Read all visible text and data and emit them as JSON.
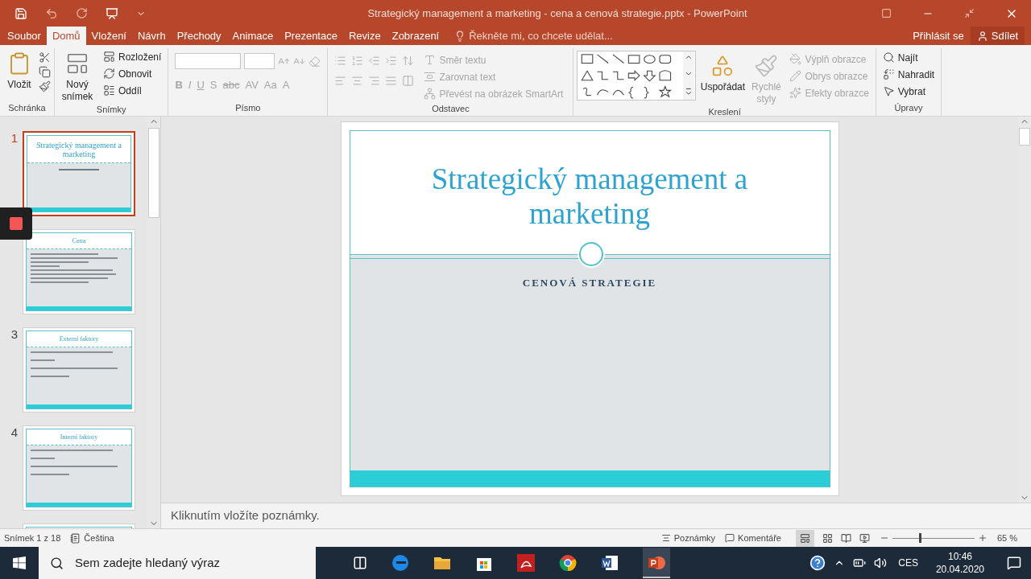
{
  "title_bar": {
    "title": "Strategický management a marketing - cena a cenová strategie.pptx - PowerPoint"
  },
  "menu_tabs": [
    {
      "label": "Soubor",
      "selected": false
    },
    {
      "label": "Domů",
      "selected": true
    },
    {
      "label": "Vložení",
      "selected": false
    },
    {
      "label": "Návrh",
      "selected": false
    },
    {
      "label": "Přechody",
      "selected": false
    },
    {
      "label": "Animace",
      "selected": false
    },
    {
      "label": "Prezentace",
      "selected": false
    },
    {
      "label": "Revize",
      "selected": false
    },
    {
      "label": "Zobrazení",
      "selected": false
    }
  ],
  "tell_me": {
    "placeholder": "Řekněte mi, co chcete udělat..."
  },
  "account": {
    "sign_in": "Přihlásit se",
    "share": "Sdílet"
  },
  "ribbon_groups": [
    {
      "kind": "clipboard",
      "name": "Schránka",
      "large": [
        {
          "label": "Vložit",
          "disabled": false
        }
      ]
    },
    {
      "kind": "slides",
      "name": "Snímky",
      "large": [
        {
          "label": "Nový snímek",
          "disabled": false
        }
      ],
      "small": [
        {
          "label": "Rozložení",
          "disabled": false
        },
        {
          "label": "Obnovit",
          "disabled": false
        },
        {
          "label": "Oddíl",
          "disabled": false
        }
      ]
    },
    {
      "kind": "font",
      "name": "Písmo",
      "format_buttons": [
        {
          "label": "B",
          "disabled": true
        },
        {
          "label": "I",
          "disabled": true
        },
        {
          "label": "U",
          "disabled": true
        },
        {
          "label": "S",
          "disabled": true
        },
        {
          "label": "abc",
          "disabled": true
        },
        {
          "label": "AV",
          "disabled": true
        },
        {
          "label": "Aa",
          "disabled": true
        },
        {
          "label": "A",
          "disabled": true
        }
      ]
    },
    {
      "kind": "paragraph",
      "name": "Odstavec",
      "small": [
        {
          "label": "Směr textu",
          "disabled": true
        },
        {
          "label": "Zarovnat text",
          "disabled": true
        },
        {
          "label": "Převést na obrázek SmartArt",
          "disabled": true
        }
      ]
    },
    {
      "kind": "drawing",
      "name": "Kreslení",
      "large": [
        {
          "label": "Uspořádat",
          "disabled": false
        },
        {
          "label": "Rychlé styly",
          "disabled": true
        }
      ],
      "small": [
        {
          "label": "Výplň obrazce",
          "disabled": true
        },
        {
          "label": "Obrys obrazce",
          "disabled": true
        },
        {
          "label": "Efekty obrazce",
          "disabled": true
        }
      ]
    },
    {
      "kind": "editing",
      "name": "Úpravy",
      "small": [
        {
          "label": "Najít",
          "disabled": false
        },
        {
          "label": "Nahradit",
          "disabled": false
        },
        {
          "label": "Vybrat",
          "disabled": false
        }
      ]
    }
  ],
  "thumbnails": [
    {
      "kind": "title",
      "number": "1",
      "selected": true,
      "title": "Strategický management a marketing"
    },
    {
      "kind": "dense",
      "selected": false,
      "title": "Cena"
    },
    {
      "kind": "list",
      "number": "3",
      "selected": false,
      "title": "Externí faktory"
    },
    {
      "kind": "list",
      "number": "4",
      "selected": false,
      "title": "Interní faktory"
    },
    {
      "kind": "blank",
      "selected": false
    }
  ],
  "slide": {
    "title": "Strategický management a marketing",
    "subtitle": "CENOVÁ STRATEGIE"
  },
  "notes": {
    "placeholder": "Kliknutím vložíte poznámky."
  },
  "status_bar": {
    "slide_info": "Snímek 1 z 18",
    "language": "Čeština",
    "notes": "Poznámky",
    "comments": "Komentáře",
    "zoom": {
      "level": 0.32,
      "reading": "65 %"
    }
  },
  "taskbar": {
    "search_placeholder": "Sem zadejte hledaný výraz",
    "input_language": "CES",
    "time": "10:46",
    "date": "20.04.2020"
  }
}
